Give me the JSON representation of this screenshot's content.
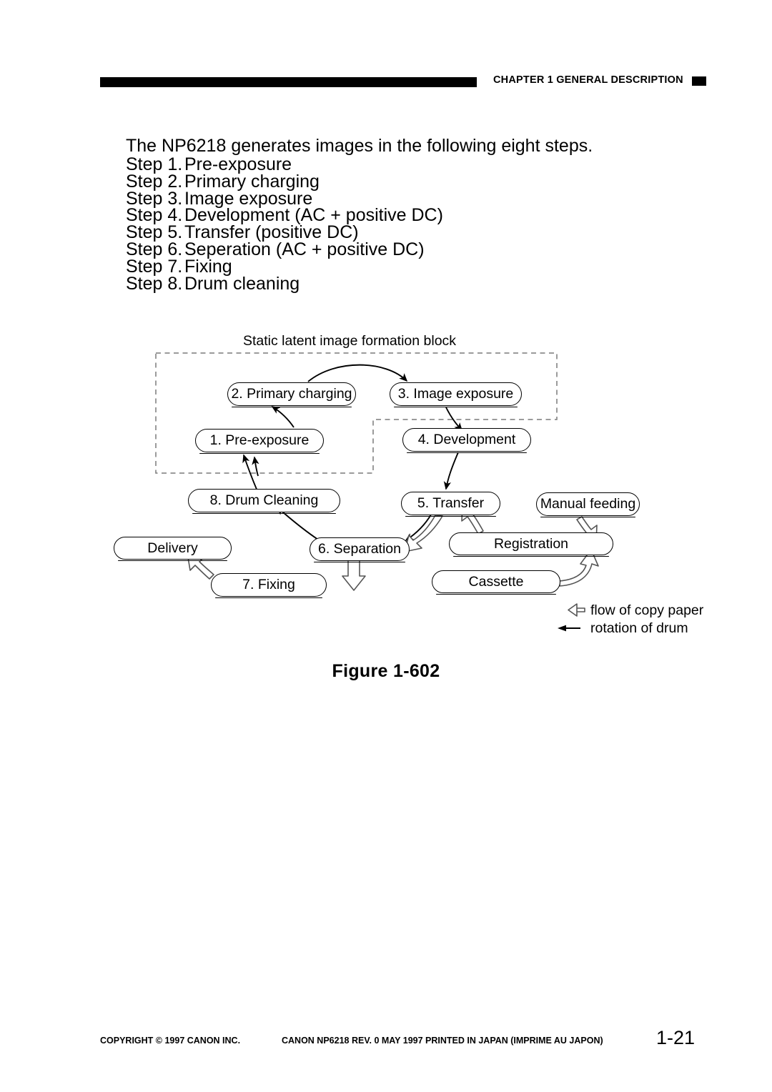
{
  "header": {
    "chapter_title": "CHAPTER 1  GENERAL DESCRIPTION"
  },
  "body": {
    "intro": "The NP6218 generates images in the following eight steps.",
    "steps": [
      {
        "label": "Step 1.",
        "text": "Pre-exposure"
      },
      {
        "label": "Step 2.",
        "text": "Primary charging"
      },
      {
        "label": "Step 3.",
        "text": "Image exposure"
      },
      {
        "label": "Step 4.",
        "text": "Development (AC + positive DC)"
      },
      {
        "label": "Step 5.",
        "text": "Transfer (positive DC)"
      },
      {
        "label": "Step 6.",
        "text": "Seperation (AC + positive DC)"
      },
      {
        "label": "Step 7.",
        "text": "Fixing"
      },
      {
        "label": "Step 8.",
        "text": "Drum cleaning"
      }
    ]
  },
  "figure": {
    "block_label": "Static latent image formation block",
    "caption": "Figure 1-602",
    "nodes": {
      "primary_charging": "2. Primary charging",
      "image_exposure": "3. Image exposure",
      "pre_exposure": "1. Pre-exposure",
      "development": "4. Development",
      "drum_cleaning": "8. Drum Cleaning",
      "transfer": "5. Transfer",
      "manual_feeding": "Manual feeding",
      "delivery": "Delivery",
      "separation": "6. Separation",
      "registration": "Registration",
      "fixing": "7. Fixing",
      "cassette": "Cassette"
    },
    "legend": [
      {
        "icon": "hollow-block-arrow-icon",
        "text": "flow of copy paper"
      },
      {
        "icon": "solid-line-arrow-icon",
        "text": "rotation of drum"
      }
    ]
  },
  "footer": {
    "copyright": "COPYRIGHT © 1997 CANON INC.",
    "print_info": "CANON NP6218 REV. 0 MAY 1997 PRINTED IN JAPAN (IMPRIME AU JAPON)",
    "page_number": "1-21"
  }
}
